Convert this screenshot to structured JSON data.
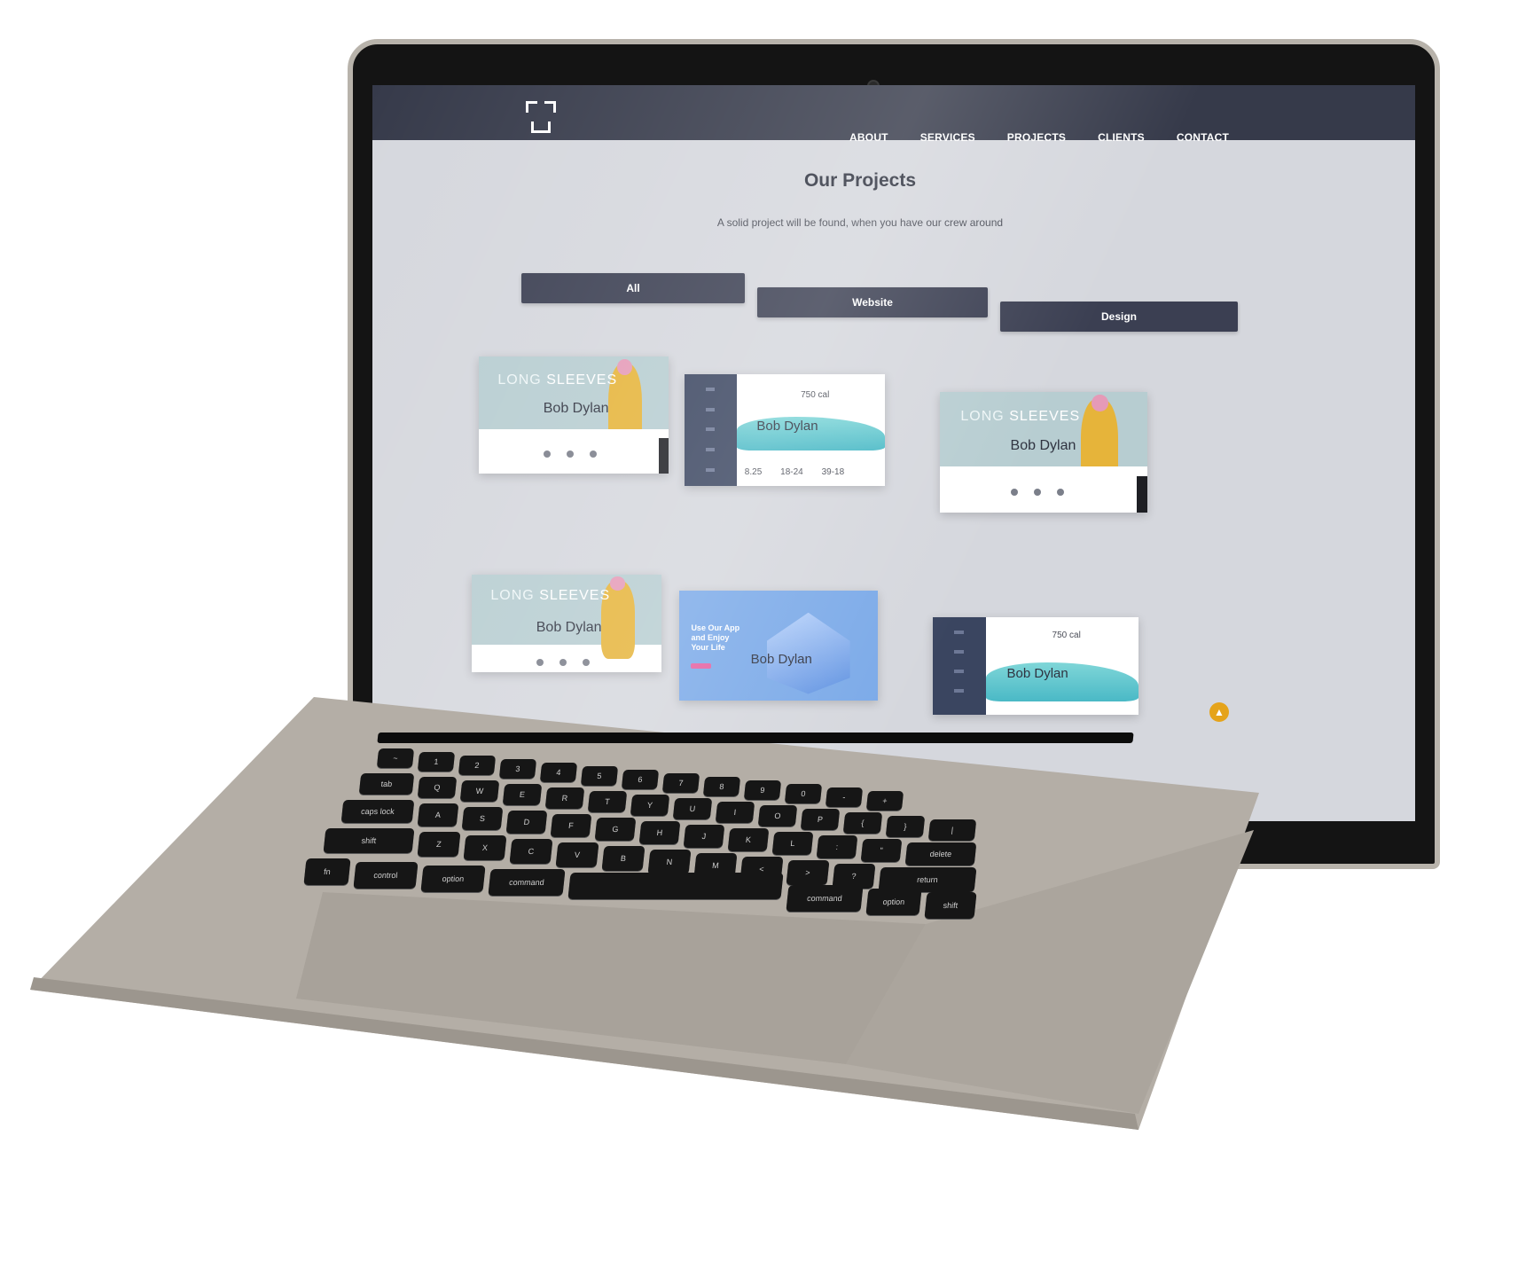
{
  "site": {
    "nav": [
      "ABOUT",
      "SERVICES",
      "PROJECTS",
      "CLIENTS",
      "CONTACT"
    ],
    "title": "Our Projects",
    "subtitle": "A solid project will be found, when you have our crew around",
    "filters": [
      "All",
      "Website",
      "Design"
    ],
    "projects": [
      {
        "type": "fashion",
        "headline_a": "LONG",
        "headline_b": "SLEEVES",
        "name": "Bob Dylan"
      },
      {
        "type": "dashboard",
        "name": "Bob Dylan",
        "calories": "750 cal",
        "stats": [
          "8.25",
          "18-24",
          "39-18"
        ]
      },
      {
        "type": "fashion",
        "headline_a": "LONG",
        "headline_b": "SLEEVES",
        "name": "Bob Dylan"
      },
      {
        "type": "fashion",
        "headline_a": "LONG",
        "headline_b": "SLEEVES",
        "name": "Bob Dylan"
      },
      {
        "type": "app",
        "tagline": "Use Our App and Enjoy Your Life",
        "name": "Bob Dylan"
      },
      {
        "type": "dashboard",
        "name": "Bob Dylan",
        "calories": "750 cal"
      }
    ],
    "scroll_top_icon": "chevron-up-icon",
    "colors": {
      "nav": "#363a4a",
      "filter": "#3b3f52",
      "accent": "#e5a31a"
    }
  },
  "keyboard": {
    "row1": [
      "~",
      "1",
      "2",
      "3",
      "4",
      "5",
      "6",
      "7",
      "8",
      "9",
      "0",
      "-",
      "+"
    ],
    "row2": [
      "tab",
      "Q",
      "W",
      "E",
      "R",
      "T",
      "Y",
      "U",
      "I",
      "O",
      "P",
      "{",
      "}",
      "|"
    ],
    "row3": [
      "caps lock",
      "A",
      "S",
      "D",
      "F",
      "G",
      "H",
      "J",
      "K",
      "L",
      ":",
      "\"",
      "delete"
    ],
    "row4": [
      "shift",
      "Z",
      "X",
      "C",
      "V",
      "B",
      "N",
      "M",
      "<",
      ">",
      "?",
      "return"
    ],
    "row5": [
      "fn",
      "control",
      "option",
      "command",
      "command",
      "option",
      "shift"
    ]
  }
}
